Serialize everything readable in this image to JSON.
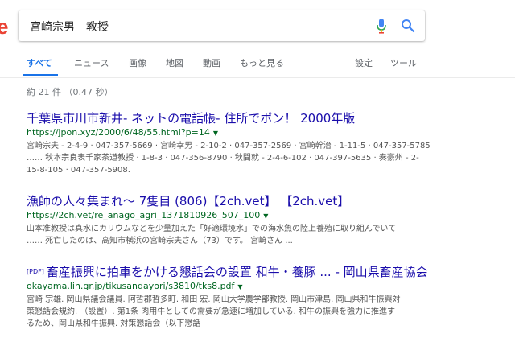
{
  "logo_fragment": "e",
  "search": {
    "query": "宮崎宗男　教授",
    "mic_icon": "microphone-icon",
    "search_icon": "search-icon"
  },
  "tabs": [
    {
      "label": "すべて",
      "active": true
    },
    {
      "label": "ニュース",
      "active": false
    },
    {
      "label": "画像",
      "active": false
    },
    {
      "label": "地図",
      "active": false
    },
    {
      "label": "動画",
      "active": false
    },
    {
      "label": "もっと見る",
      "active": false
    },
    {
      "label": "設定",
      "active": false
    },
    {
      "label": "ツール",
      "active": false
    }
  ],
  "stats": "約 21 件 （0.47 秒）",
  "results": [
    {
      "title": "千葉県市川市新井- ネットの電話帳- 住所でポン！ 2000年版",
      "url": "https://jpon.xyz/2000/6/48/55.html?p=14",
      "snippet": [
        "宮崎宗夫 - 2-4-9 · 047-357-5669 · 宮崎幸男 - 2-10-2 · 047-357-2569 · 宮崎幹治 - 1-11-5 · 047-357-5785",
        "…… 秋本宗良表千家茶道教授 · 1-8-3 · 047-356-8790 · 秋間就 - 2-4-6-102 · 047-397-5635 · 奏豪州 - 2-",
        "15-8-105 · 047-357-5908."
      ]
    },
    {
      "title": "漁師の人々集まれ～ 7隻目 (806)【2ch.vet】 【2ch.vet】",
      "url": "https://2ch.vet/re_anago_agri_1371810926_507_100",
      "snippet": [
        "山本准教授は真水にカリウムなどを少量加えた「好適環境水」での海水魚の陸上養殖に取り組んでいて",
        "…… 死亡したのは、高知市横浜の宮崎宗夫さん（73）です。 宮崎さん ..."
      ]
    },
    {
      "pdf_tag": "[PDF]",
      "title": "畜産振興に拍車をかける懇話会の設置 和牛・養豚 ... - 岡山県畜産協会",
      "url": "okayama.lin.gr.jp/tikusandayori/s3810/tks8.pdf",
      "snippet": [
        "宮崎 宗雄. 岡山県議会議員. 阿哲郡哲多町. 和田 宏. 岡山大学農学部教授. 岡山市津島. 岡山県和牛振興対",
        "策懇話会規約. （設置）. 第1条 肉用牛としての需要が急速に増加している. 和牛の振興を強力に推進す",
        "るため、岡山県和牛振興. 対策懇話会（以下懇話"
      ]
    }
  ]
}
